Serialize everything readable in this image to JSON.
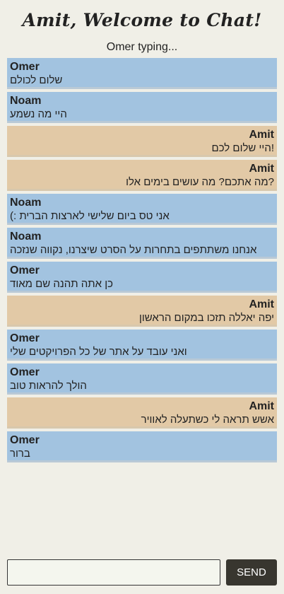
{
  "header": {
    "title": "Amit, Welcome to Chat!",
    "typing_status": "Omer typing..."
  },
  "messages": [
    {
      "sender": "Omer",
      "text": "שלום לכולם",
      "mine": false
    },
    {
      "sender": "Noam",
      "text": "היי מה נשמע",
      "mine": false
    },
    {
      "sender": "Amit",
      "text": "!היי שלום לכם",
      "mine": true
    },
    {
      "sender": "Amit",
      "text": "?מה אתכם? מה עושים בימים אלו",
      "mine": true
    },
    {
      "sender": "Noam",
      "text": "אני טס ביום שלישי לארצות הברית :)",
      "mine": false
    },
    {
      "sender": "Noam",
      "text": "אנחנו משתתפים בתחרות על הסרט שיצרנו, נקווה שנזכה",
      "mine": false
    },
    {
      "sender": "Omer",
      "text": "כן אתה תהנה שם מאוד",
      "mine": false
    },
    {
      "sender": "Amit",
      "text": "יפה יאללה תזכו במקום הראשון",
      "mine": true
    },
    {
      "sender": "Omer",
      "text": "ואני עובד על אתר של כל הפרויקטים שלי",
      "mine": false
    },
    {
      "sender": "Omer",
      "text": "הולך להראות טוב",
      "mine": false
    },
    {
      "sender": "Amit",
      "text": "אשש תראה לי כשתעלה לאוויר",
      "mine": true
    },
    {
      "sender": "Omer",
      "text": "ברור",
      "mine": false
    }
  ],
  "composer": {
    "input_value": "",
    "input_placeholder": "",
    "send_label": "SEND"
  },
  "colors": {
    "background": "#f0efe7",
    "other_message": "#a2c3e0",
    "own_message": "#e2c9a6",
    "send_button": "#38362f"
  }
}
